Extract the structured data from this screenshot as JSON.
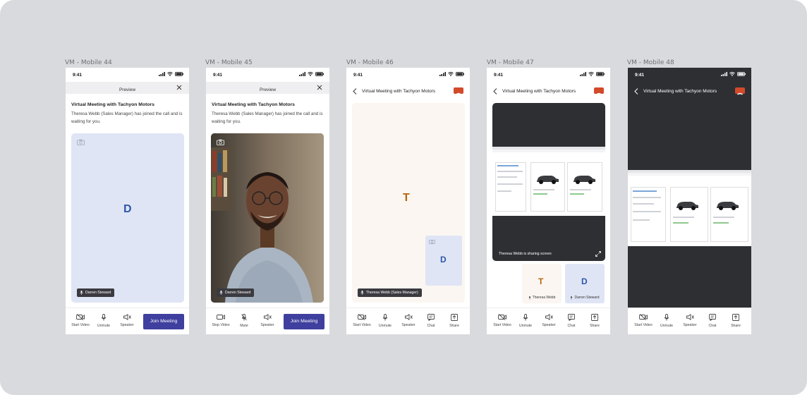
{
  "frames": [
    {
      "label": "VM - Mobile 44"
    },
    {
      "label": "VM - Mobile 45"
    },
    {
      "label": "VM - Mobile 46"
    },
    {
      "label": "VM - Mobile 47"
    },
    {
      "label": "VM - Mobile 48"
    }
  ],
  "status": {
    "time": "9:41"
  },
  "preview": {
    "header": "Preview",
    "title": "Virtual Meeting with Tachyon Motors",
    "description": "Theresa Webb (Sales Manager) has joined the call and is waiting for you."
  },
  "meeting": {
    "title": "Virtual Meeting with Tachyon Motors"
  },
  "participants": {
    "self_name": "Darren Steward",
    "self_initial": "D",
    "host_initial": "T",
    "host_chip": "Theresa Webb (Sales Manager)",
    "host_tile": "Theresa Webb",
    "sharing_text": "Theresa Webb is sharing screen"
  },
  "toolbar": {
    "start_video": "Start Video",
    "stop_video": "Stop Video",
    "unmute": "Unmute",
    "mute": "Mute",
    "speaker": "Speaker",
    "chat": "Chat",
    "share": "Share",
    "join": "Join Meeting"
  },
  "colors": {
    "primary": "#3f3f9f",
    "end_call": "#d34a2b",
    "avatar_blue_bg": "#dfe5f5",
    "avatar_blue_text": "#2f56a8",
    "avatar_peach_bg": "#fbf6f1",
    "avatar_orange_text": "#b8650f",
    "dark_bg": "#2e2f33"
  }
}
